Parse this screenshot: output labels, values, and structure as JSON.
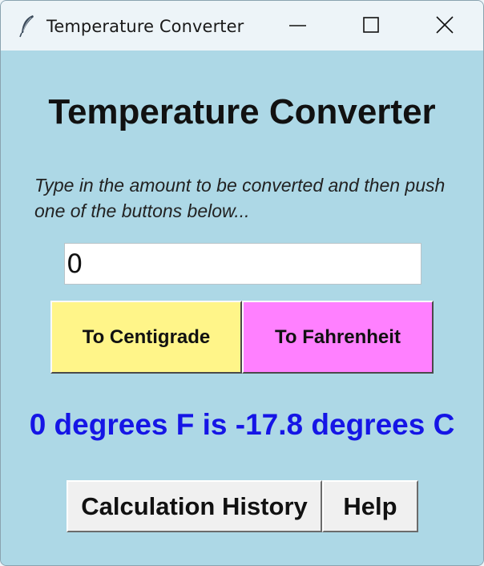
{
  "window": {
    "title": "Temperature Converter",
    "controls": {
      "minimize": "minimize-icon",
      "maximize": "maximize-icon",
      "close": "close-icon"
    }
  },
  "main": {
    "heading": "Temperature Converter",
    "instructions": "Type in the amount to be converted and then push one of the buttons below...",
    "amount_input_value": "0",
    "to_centigrade_label": "To Centigrade",
    "to_fahrenheit_label": "To Fahrenheit",
    "result_text": "0 degrees F is -17.8 degrees C",
    "history_label": "Calculation History",
    "help_label": "Help"
  },
  "colors": {
    "background": "#add8e6",
    "centigrade_button": "#fff589",
    "fahrenheit_button": "#ff80ff",
    "result_text": "#1515e6"
  }
}
